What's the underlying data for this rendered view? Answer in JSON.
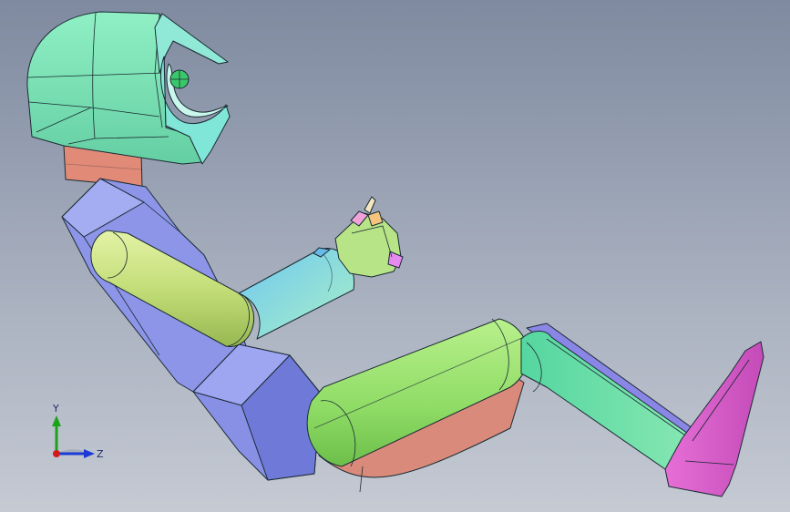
{
  "triad": {
    "y_label": "Y",
    "z_label": "Z",
    "y_color": "#1aa31a",
    "z_color": "#1c3bd6",
    "origin_color": "#d31a1a"
  },
  "colors": {
    "helmet": "#7ee0b4",
    "visor": "#7fe6d8",
    "neck": "#e08a77",
    "torso": "#8d95e8",
    "upper_arm": "#c3e07a",
    "forearm": "#8fe3c6",
    "hand": "#b7e487",
    "thigh": "#9ae070",
    "shin": "#6fe0a5",
    "foot": "#e070d0"
  }
}
